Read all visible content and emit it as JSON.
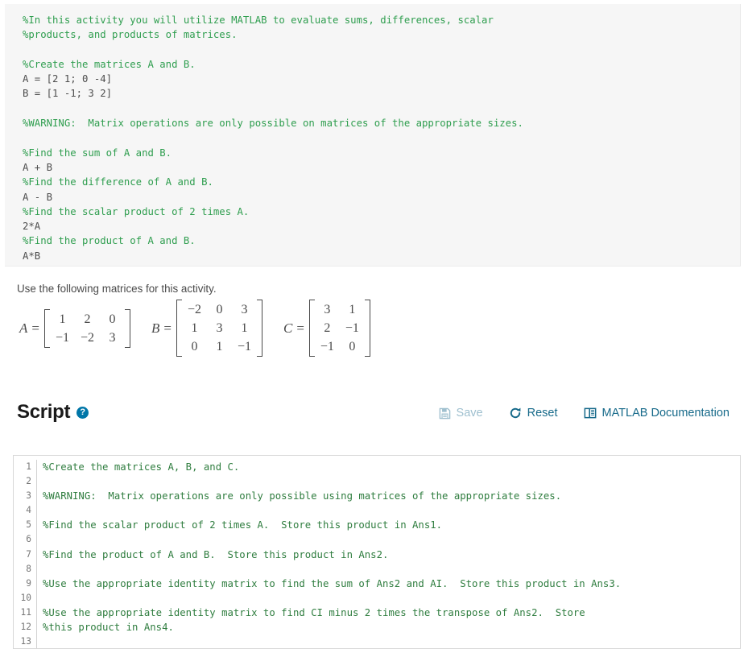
{
  "instruction_block": {
    "lines": [
      {
        "text": "%In this activity you will utilize MATLAB to evaluate sums, differences, scalar",
        "kind": "comment"
      },
      {
        "text": "%products, and products of matrices.",
        "kind": "comment"
      },
      {
        "text": " ",
        "kind": "blank"
      },
      {
        "text": "%Create the matrices A and B.",
        "kind": "comment"
      },
      {
        "text": "A = [2 1; 0 -4]",
        "kind": "source"
      },
      {
        "text": "B = [1 -1; 3 2]",
        "kind": "source"
      },
      {
        "text": " ",
        "kind": "blank"
      },
      {
        "text": "%WARNING:  Matrix operations are only possible on matrices of the appropriate sizes.",
        "kind": "comment"
      },
      {
        "text": " ",
        "kind": "blank"
      },
      {
        "text": "%Find the sum of A and B.",
        "kind": "comment"
      },
      {
        "text": "A + B",
        "kind": "source"
      },
      {
        "text": "%Find the difference of A and B.",
        "kind": "comment"
      },
      {
        "text": "A - B",
        "kind": "source"
      },
      {
        "text": "%Find the scalar product of 2 times A.",
        "kind": "comment"
      },
      {
        "text": "2*A",
        "kind": "source"
      },
      {
        "text": "%Find the product of A and B.",
        "kind": "comment"
      },
      {
        "text": "A*B",
        "kind": "source"
      }
    ]
  },
  "prose": {
    "matrices_intro": "Use the following matrices for this activity."
  },
  "matrices": [
    {
      "name": "A",
      "equals": "=",
      "rows": 2,
      "cols": 3,
      "values": [
        [
          "1",
          "2",
          "0"
        ],
        [
          "−1",
          "−2",
          "3"
        ]
      ]
    },
    {
      "name": "B",
      "equals": "=",
      "rows": 3,
      "cols": 3,
      "values": [
        [
          "−2",
          "0",
          "3"
        ],
        [
          "1",
          "3",
          "1"
        ],
        [
          "0",
          "1",
          "−1"
        ]
      ]
    },
    {
      "name": "C",
      "equals": "=",
      "rows": 3,
      "cols": 2,
      "values": [
        [
          "3",
          "1"
        ],
        [
          "2",
          "−1"
        ],
        [
          "−1",
          "0"
        ]
      ]
    }
  ],
  "script_section": {
    "title": "Script",
    "help_glyph": "?",
    "toolbar": {
      "save_label": "Save",
      "reset_label": "Reset",
      "docs_label": "MATLAB Documentation"
    }
  },
  "editor": {
    "line_numbers": [
      "1",
      "2",
      "3",
      "4",
      "5",
      "6",
      "7",
      "8",
      "9",
      "10",
      "11",
      "12",
      "13"
    ],
    "lines": [
      "%Create the matrices A, B, and C.",
      "",
      "%WARNING:  Matrix operations are only possible using matrices of the appropriate sizes.",
      "",
      "%Find the scalar product of 2 times A.  Store this product in Ans1.",
      "",
      "%Find the product of A and B.  Store this product in Ans2.",
      "",
      "%Use the appropriate identity matrix to find the sum of Ans2 and AI.  Store this product in Ans3.",
      "",
      "%Use the appropriate identity matrix to find CI minus 2 times the transpose of Ans2.  Store",
      "%this product in Ans4.",
      ""
    ]
  },
  "colors": {
    "comment_green": "#2f9e4f",
    "source_grey": "#4d4d4d",
    "code_background": "#f6f6f6",
    "accent_blue": "#176a8a",
    "disabled_blue": "#9fc0cf",
    "help_badge": "#0076a8"
  }
}
